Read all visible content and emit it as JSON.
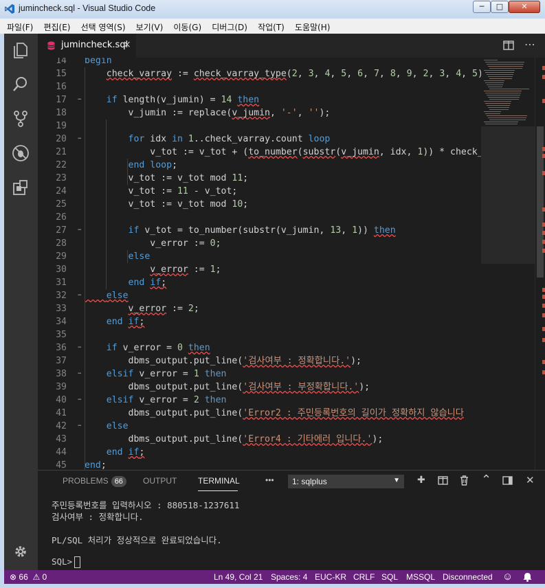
{
  "window": {
    "title": "jumincheck.sql - Visual Studio Code",
    "minimize": "─",
    "maximize": "□",
    "close": "✕"
  },
  "menu": [
    "파일(F)",
    "편집(E)",
    "선택 영역(S)",
    "보기(V)",
    "이동(G)",
    "디버그(D)",
    "작업(T)",
    "도움말(H)"
  ],
  "tab": {
    "filename": "jumincheck.sql",
    "close": "×"
  },
  "editor": {
    "lines": [
      {
        "n": "14",
        "segs": [
          [
            "kw",
            "begin"
          ]
        ]
      },
      {
        "n": "15",
        "segs": [
          [
            "",
            "    "
          ],
          [
            "err",
            "check_varray"
          ],
          [
            "",
            " := "
          ],
          [
            "err",
            "check_varray_type"
          ],
          [
            "",
            "("
          ],
          [
            "num",
            "2"
          ],
          [
            "",
            ", "
          ],
          [
            "num",
            "3"
          ],
          [
            "",
            ", "
          ],
          [
            "num",
            "4"
          ],
          [
            "",
            ", "
          ],
          [
            "num",
            "5"
          ],
          [
            "",
            ", "
          ],
          [
            "num",
            "6"
          ],
          [
            "",
            ", "
          ],
          [
            "num",
            "7"
          ],
          [
            "",
            ", "
          ],
          [
            "num",
            "8"
          ],
          [
            "",
            ", "
          ],
          [
            "num",
            "9"
          ],
          [
            "",
            ", "
          ],
          [
            "num",
            "2"
          ],
          [
            "",
            ", "
          ],
          [
            "num",
            "3"
          ],
          [
            "",
            ", "
          ],
          [
            "num",
            "4"
          ],
          [
            "",
            ", "
          ],
          [
            "num",
            "5"
          ],
          [
            "",
            ");"
          ]
        ]
      },
      {
        "n": "16",
        "segs": []
      },
      {
        "n": "17",
        "segs": [
          [
            "",
            "    "
          ],
          [
            "kw",
            "if"
          ],
          [
            "",
            " length(v_jumin) = "
          ],
          [
            "num",
            "14"
          ],
          [
            "",
            " "
          ],
          [
            "kw err",
            "then"
          ]
        ]
      },
      {
        "n": "18",
        "segs": [
          [
            "",
            "        v_jumin := replace("
          ],
          [
            "err",
            "v_jumin"
          ],
          [
            "",
            ", "
          ],
          [
            "str",
            "'-'"
          ],
          [
            "",
            ", "
          ],
          [
            "str",
            "''"
          ],
          [
            "",
            ");"
          ]
        ]
      },
      {
        "n": "19",
        "segs": []
      },
      {
        "n": "20",
        "segs": [
          [
            "",
            "        "
          ],
          [
            "kw",
            "for"
          ],
          [
            "",
            " idx "
          ],
          [
            "kw",
            "in"
          ],
          [
            "",
            " "
          ],
          [
            "num",
            "1"
          ],
          [
            "",
            "..check_varray.count "
          ],
          [
            "kw",
            "loop"
          ]
        ]
      },
      {
        "n": "21",
        "segs": [
          [
            "",
            "            v_tot := v_tot + ("
          ],
          [
            "err",
            "to_number"
          ],
          [
            "",
            "("
          ],
          [
            "err",
            "substr"
          ],
          [
            "",
            "("
          ],
          [
            "err",
            "v_jumin"
          ],
          [
            "",
            ", idx, "
          ],
          [
            "num",
            "1"
          ],
          [
            "",
            ")) * check_va"
          ]
        ]
      },
      {
        "n": "22",
        "segs": [
          [
            "",
            "        "
          ],
          [
            "kw",
            "end loop"
          ],
          [
            "",
            ";"
          ]
        ]
      },
      {
        "n": "23",
        "segs": [
          [
            "",
            "        v_tot := v_tot mod "
          ],
          [
            "num",
            "11"
          ],
          [
            "",
            ";"
          ]
        ]
      },
      {
        "n": "24",
        "segs": [
          [
            "",
            "        v_tot := "
          ],
          [
            "num",
            "11"
          ],
          [
            "",
            " - v_tot;"
          ]
        ]
      },
      {
        "n": "25",
        "segs": [
          [
            "",
            "        v_tot := v_tot mod "
          ],
          [
            "num",
            "10"
          ],
          [
            "",
            ";"
          ]
        ]
      },
      {
        "n": "26",
        "segs": []
      },
      {
        "n": "27",
        "segs": [
          [
            "",
            "        "
          ],
          [
            "kw",
            "if"
          ],
          [
            "",
            " v_tot = to_number(substr(v_jumin, "
          ],
          [
            "num",
            "13"
          ],
          [
            "",
            ", "
          ],
          [
            "num",
            "1"
          ],
          [
            "",
            ")) "
          ],
          [
            "kw err",
            "then"
          ]
        ]
      },
      {
        "n": "28",
        "segs": [
          [
            "",
            "            v_error := "
          ],
          [
            "num",
            "0"
          ],
          [
            "",
            ";"
          ]
        ]
      },
      {
        "n": "29",
        "segs": [
          [
            "",
            "        "
          ],
          [
            "kw",
            "else"
          ]
        ]
      },
      {
        "n": "30",
        "segs": [
          [
            "",
            "            "
          ],
          [
            "err",
            "v_error"
          ],
          [
            "",
            " := "
          ],
          [
            "num",
            "1"
          ],
          [
            "",
            ";"
          ]
        ]
      },
      {
        "n": "31",
        "segs": [
          [
            "",
            "        "
          ],
          [
            "kw",
            "end"
          ],
          [
            "",
            " "
          ],
          [
            "kw err",
            "if"
          ],
          [
            "err",
            ";"
          ]
        ]
      },
      {
        "n": "32",
        "segs": [
          [
            "err",
            "    "
          ],
          [
            "kw err",
            "else"
          ]
        ]
      },
      {
        "n": "33",
        "segs": [
          [
            "",
            "        "
          ],
          [
            "err",
            "v_error"
          ],
          [
            "",
            " := "
          ],
          [
            "num",
            "2"
          ],
          [
            "",
            ";"
          ]
        ]
      },
      {
        "n": "34",
        "segs": [
          [
            "",
            "    "
          ],
          [
            "kw",
            "end"
          ],
          [
            "",
            " "
          ],
          [
            "kw err",
            "if"
          ],
          [
            "err",
            ";"
          ]
        ]
      },
      {
        "n": "35",
        "segs": []
      },
      {
        "n": "36",
        "segs": [
          [
            "",
            "    "
          ],
          [
            "kw",
            "if"
          ],
          [
            "",
            " v_error = "
          ],
          [
            "num",
            "0"
          ],
          [
            "",
            " "
          ],
          [
            "kw err",
            "then"
          ]
        ]
      },
      {
        "n": "37",
        "segs": [
          [
            "",
            "        dbms_output.put_line("
          ],
          [
            "str err",
            "'검사여부 : 정확합니다.'"
          ],
          [
            "",
            ");"
          ]
        ]
      },
      {
        "n": "38",
        "segs": [
          [
            "",
            "    "
          ],
          [
            "kw",
            "elsif"
          ],
          [
            "",
            " v_error = "
          ],
          [
            "num",
            "1"
          ],
          [
            "",
            " "
          ],
          [
            "kw",
            "then"
          ]
        ]
      },
      {
        "n": "39",
        "segs": [
          [
            "",
            "        dbms_output.put_line("
          ],
          [
            "str err",
            "'검사여부 : 부정확합니다.'"
          ],
          [
            "",
            ");"
          ]
        ]
      },
      {
        "n": "40",
        "segs": [
          [
            "",
            "    "
          ],
          [
            "kw",
            "elsif"
          ],
          [
            "",
            " v_error = "
          ],
          [
            "num",
            "2"
          ],
          [
            "",
            " "
          ],
          [
            "kw",
            "then"
          ]
        ]
      },
      {
        "n": "41",
        "segs": [
          [
            "",
            "        dbms_output.put_line("
          ],
          [
            "str err",
            "'Error2 : 주민등록번호의 길이가 정확하지 않습니다"
          ]
        ]
      },
      {
        "n": "42",
        "segs": [
          [
            "",
            "    "
          ],
          [
            "kw",
            "else"
          ]
        ]
      },
      {
        "n": "43",
        "segs": [
          [
            "",
            "        dbms_output.put_line("
          ],
          [
            "str err",
            "'Error4 : 기타에러 입니다.'"
          ],
          [
            "",
            ");"
          ]
        ]
      },
      {
        "n": "44",
        "segs": [
          [
            "",
            "    "
          ],
          [
            "kw",
            "end"
          ],
          [
            "",
            " "
          ],
          [
            "kw err",
            "if"
          ],
          [
            "err",
            ";"
          ]
        ]
      },
      {
        "n": "45",
        "segs": [
          [
            "kw",
            "end"
          ],
          [
            "",
            ";"
          ]
        ]
      }
    ]
  },
  "panel": {
    "tabs": [
      {
        "label": "PROBLEMS",
        "badge": "66"
      },
      {
        "label": "OUTPUT"
      },
      {
        "label": "TERMINAL"
      }
    ],
    "more": "•••",
    "terminal_select": "1: sqlplus",
    "terminal_lines": [
      "주민등록번호를 입력하시오 : 880518-1237611",
      "검사여부 : 정확합니다.",
      "",
      "PL/SQL 처리가 정상적으로 완료되었습니다.",
      "",
      "SQL>"
    ]
  },
  "status": {
    "errors": "66",
    "warnings": "0",
    "position": "Ln 49, Col 21",
    "spaces": "Spaces: 4",
    "encoding": "EUC-KR",
    "eol": "CRLF",
    "language": "SQL",
    "server": "MSSQL",
    "connection": "Disconnected"
  },
  "colors": {
    "statusbar": "#68217a",
    "editor_bg": "#1e1e1e",
    "keyword": "#569cd6",
    "number": "#b5cea8",
    "string": "#ce9178",
    "error_squiggle": "#f14c4c"
  }
}
